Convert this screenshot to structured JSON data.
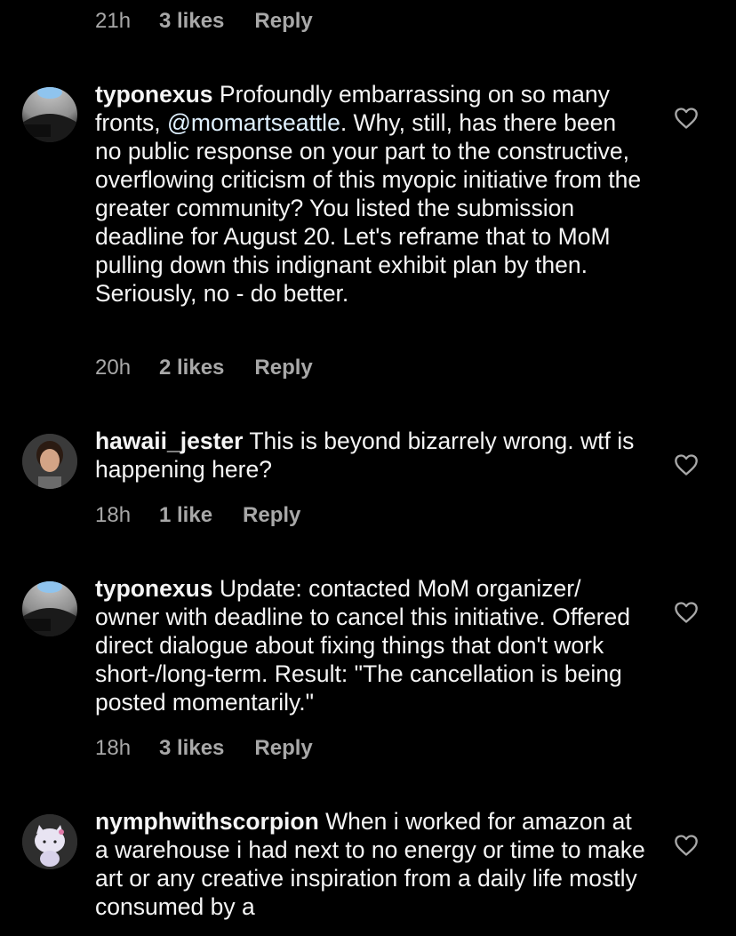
{
  "top_meta": {
    "time": "21h",
    "likes": "3 likes",
    "reply": "Reply"
  },
  "comments": [
    {
      "username": "typonexus",
      "text_before": " Profoundly embarrassing on so many fronts, ",
      "mention": "@momartseattle",
      "text_after": ". Why, still, has there been no public response on your part to the constructive, overflowing criticism of this myopic initiative from the greater community? You listed the submission deadline for August 20. Let's reframe that to MoM pulling down this indignant exhibit plan by then. Seriously, no - do better.",
      "time": "20h",
      "likes": "2 likes",
      "reply": "Reply",
      "avatar_icon": "concrete-dome-avatar"
    },
    {
      "username": "hawaii_jester",
      "text_before": " This is beyond bizarrely wrong. wtf is happening here?",
      "time": "18h",
      "likes": "1 like",
      "reply": "Reply",
      "avatar_icon": "person-portrait-avatar"
    },
    {
      "username": "typonexus",
      "text_before": " Update: contacted MoM organizer/ owner with deadline to cancel this initiative. Offered direct dialogue about fixing things that don't work short-/long-term. Result: \"The cancellation is being posted momentarily.\"",
      "time": "18h",
      "likes": "3 likes",
      "reply": "Reply",
      "avatar_icon": "concrete-dome-avatar"
    },
    {
      "username": "nymphwithscorpion",
      "text_before": " When i worked for amazon at a warehouse i had next to no energy or time to make art or any creative inspiration from a daily life mostly consumed by a",
      "avatar_icon": "hello-kitty-avatar"
    }
  ],
  "colors": {
    "background": "#000000",
    "text": "#f5f5f5",
    "meta": "#a8a8a8",
    "mention": "#e0f1ff"
  },
  "icons": {
    "like": "heart-outline-icon"
  }
}
